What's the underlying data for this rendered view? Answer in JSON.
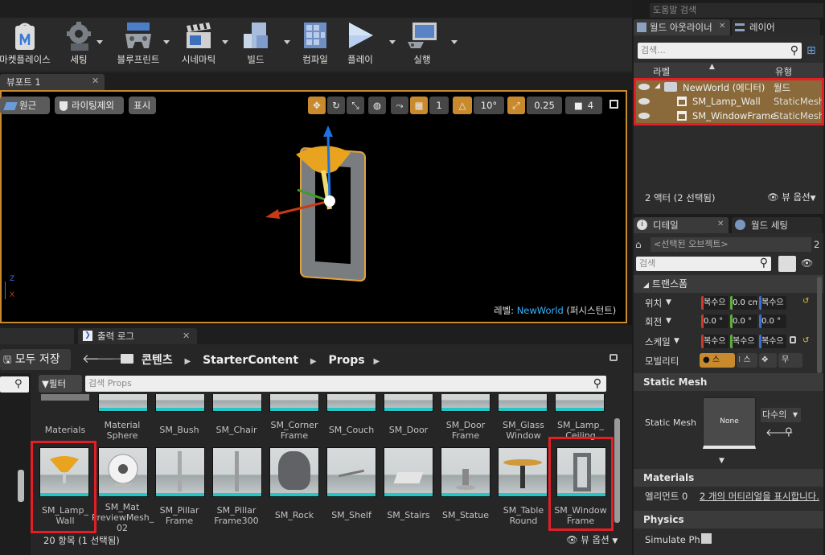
{
  "toolbar": {
    "buttons": [
      {
        "label": "마켓플레이스",
        "icon": "marketplace-icon"
      },
      {
        "label": "세팅",
        "icon": "settings-gear-icon"
      },
      {
        "label": "블루프린트",
        "icon": "blueprint-gamepad-icon"
      },
      {
        "label": "시네마틱",
        "icon": "cinematic-clapper-icon"
      },
      {
        "label": "빌드",
        "icon": "build-cubes-icon"
      },
      {
        "label": "컴파일",
        "icon": "compile-icon"
      },
      {
        "label": "플레이",
        "icon": "play-icon"
      },
      {
        "label": "실행",
        "icon": "launch-monitor-icon"
      }
    ]
  },
  "help_search": {
    "placeholder": "도움말 검색"
  },
  "viewport": {
    "tab_label": "뷰포트 1",
    "perspective_label": "원근",
    "lit_label": "라이팅제외",
    "show_label": "표시",
    "grid_snap_value": "1",
    "rotation_snap_value": "10°",
    "scale_snap_value": "0.25",
    "camera_speed_value": "4",
    "level_prefix": "레벨:",
    "level_name": "NewWorld",
    "level_suffix": "(퍼시스턴트)",
    "axis_labels": {
      "z": "Z",
      "x": "X"
    }
  },
  "outliner": {
    "tab_label": "월드 아웃라이너",
    "layers_tab_label": "레이어",
    "search_placeholder": "검색...",
    "col_label": "라벨",
    "col_type": "유형",
    "rows": [
      {
        "name": "NewWorld (에디터)",
        "type": "월드"
      },
      {
        "name": "SM_Lamp_Wall",
        "type": "StaticMesh"
      },
      {
        "name": "SM_WindowFrame",
        "type": "StaticMesh"
      }
    ],
    "footer_count": "2 액터 (2 선택됨)",
    "view_options": "뷰 옵션"
  },
  "details": {
    "tab_label": "디테일",
    "world_settings_tab": "월드 세팅",
    "selected_placeholder": "<선택된 오브젝트>",
    "selected_count": "2",
    "search_placeholder": "검색",
    "transform_header": "트랜스폼",
    "location_label": "위치",
    "rotation_label": "회전",
    "scale_label": "스케일",
    "mobility_label": "모빌리티",
    "location_values": [
      "복수으",
      "0.0 cm",
      "복수으"
    ],
    "rotation_values": [
      "0.0 °",
      "0.0 °",
      "0.0 °"
    ],
    "scale_values": [
      "복수으",
      "복수으",
      "복수으"
    ],
    "mobility_values": [
      "스",
      "스",
      "무"
    ],
    "static_mesh_header": "Static Mesh",
    "static_mesh_label": "Static Mesh",
    "static_mesh_thumb": "None",
    "static_mesh_value": "다수의",
    "materials_header": "Materials",
    "element_label": "엘리먼트 0",
    "element_link": "2 개의 머티리얼을 표시합니다.",
    "physics_header": "Physics",
    "simulate_label": "Simulate Ph"
  },
  "output_log": {
    "tab_label": "출력 로그"
  },
  "content_browser": {
    "save_all": "모두 저장",
    "path": [
      "콘텐츠",
      "StarterContent",
      "Props"
    ],
    "filter_label": "필터",
    "search_placeholder": "검색 Props",
    "top_row": [
      "Materials",
      "Material Sphere",
      "SM_Bush",
      "SM_Chair",
      "SM_Corner Frame",
      "SM_Couch",
      "SM_Door",
      "SM_Door Frame",
      "SM_Glass Window",
      "SM_Lamp_ Ceiling"
    ],
    "bottom_row": [
      "SM_Lamp_ Wall",
      "SM_Mat PreviewMesh_ 02",
      "SM_Pillar Frame",
      "SM_Pillar Frame300",
      "SM_Rock",
      "SM_Shelf",
      "SM_Stairs",
      "SM_Statue",
      "SM_Table Round",
      "SM_Window Frame"
    ],
    "footer_count": "20 항목 (1 선택됨)",
    "view_options": "뷰 옵션"
  },
  "colors": {
    "accent_orange": "#c88a2c",
    "highlight_red": "#e41e26",
    "level_name": "#35b4ff"
  }
}
